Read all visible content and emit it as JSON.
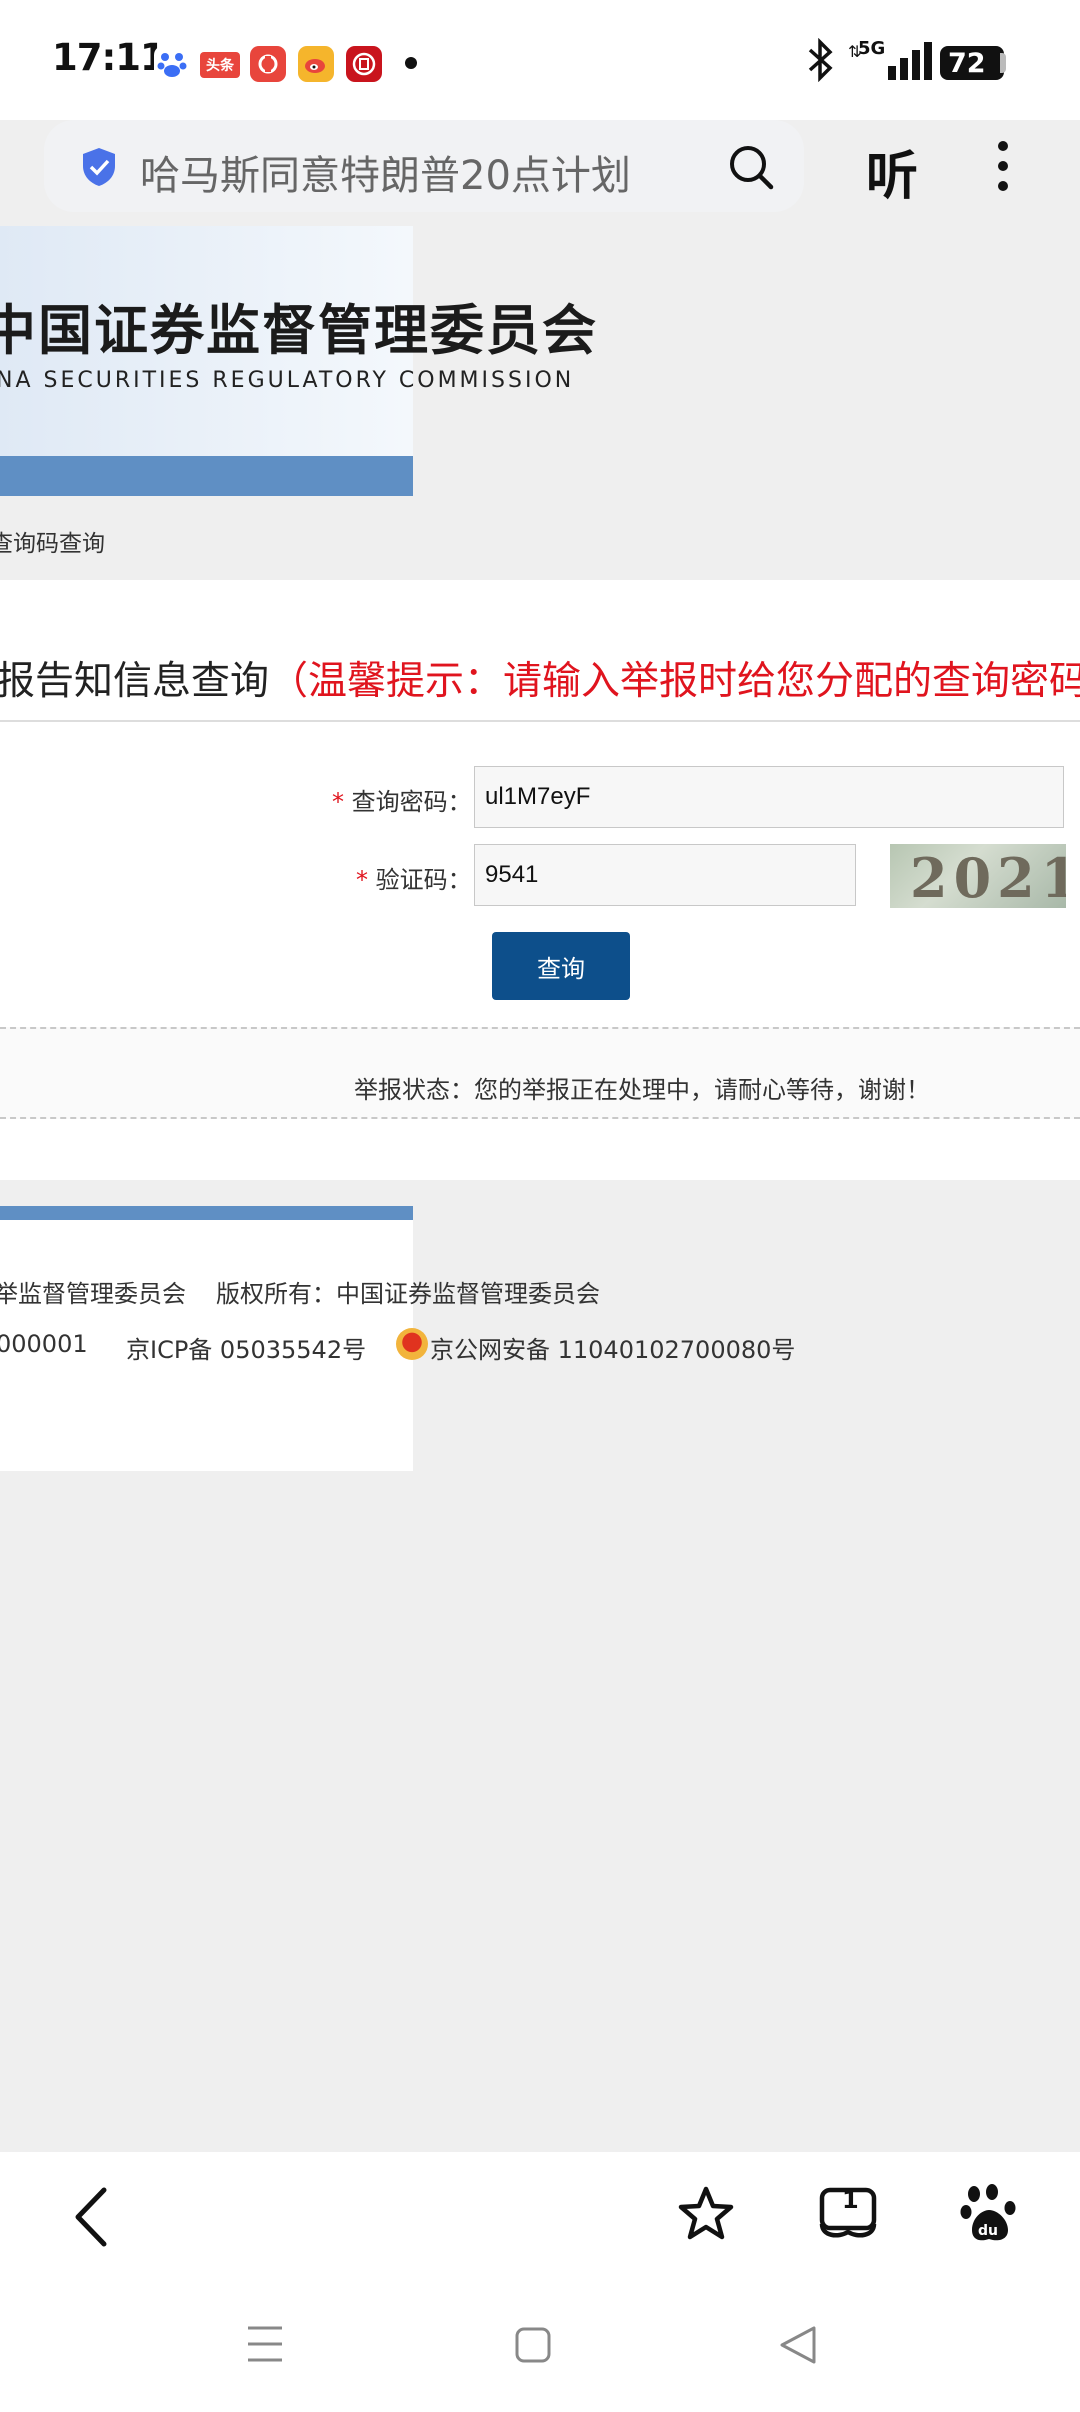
{
  "status_bar": {
    "time": "17:11",
    "notifications": [
      {
        "icon": "baidu-paw-icon",
        "color": "#3b6ef5",
        "label": ""
      },
      {
        "icon": "toutiao-icon",
        "color": "#e8453c",
        "label": "头条"
      },
      {
        "icon": "red-app-icon",
        "color": "#e8453c",
        "label": ""
      },
      {
        "icon": "weibo-icon",
        "color": "#f5b52c",
        "label": ""
      },
      {
        "icon": "bank-icon",
        "color": "#c9141d",
        "label": ""
      }
    ],
    "network": "5G",
    "battery": "72"
  },
  "search": {
    "query": "哈马斯同意特朗普20点计划",
    "listen_label": "听"
  },
  "banner": {
    "title": "中国证券监督管理委员会",
    "subtitle": "NA SECURITIES REGULATORY COMMISSION",
    "breadcrumb": "查询码查询"
  },
  "form": {
    "heading": "报告知信息查询",
    "heading_tip": "（温馨提示：请输入举报时给您分配的查询密码",
    "password_label": "查询密码：",
    "password_value": "ul1M7eyF",
    "captcha_label": "验证码：",
    "captcha_value": "9541",
    "captcha_image_text": "2021",
    "required_mark": "*",
    "submit_label": "查询"
  },
  "report_status": {
    "text": "举报状态：您的举报正在处理中，请耐心等待，谢谢！"
  },
  "footer": {
    "line1_left": "举监督管理委员会",
    "line1_right": "版权所有：中国证券监督管理委员会",
    "line2_left": "000001",
    "icp": "京ICP备 05035542号",
    "police": "京公网安备 11040102700080号"
  },
  "toolbar": {
    "tabs_count": "1"
  }
}
